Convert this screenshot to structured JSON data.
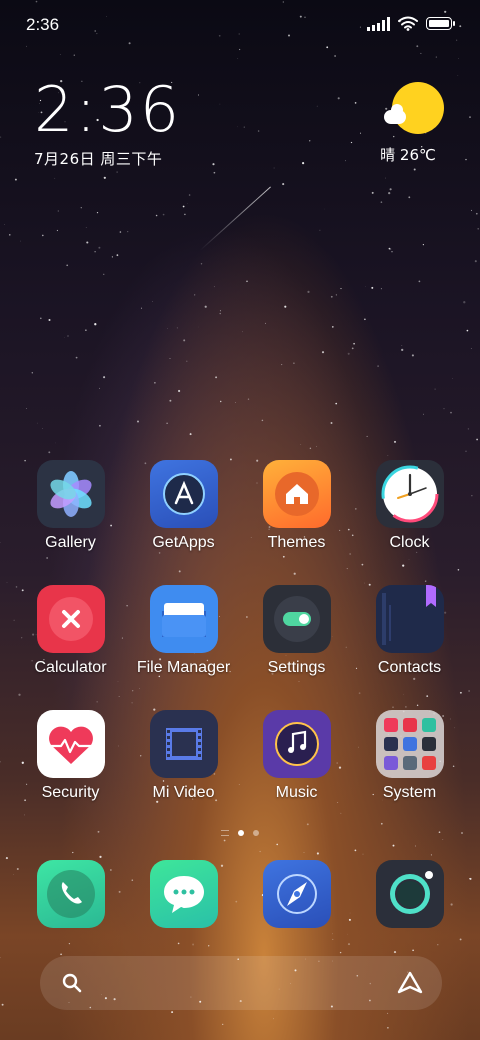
{
  "status_bar": {
    "time": "2:36"
  },
  "clock_widget": {
    "time": "2:36",
    "date": "7月26日 周三下午"
  },
  "weather": {
    "text": "晴 26℃"
  },
  "apps": [
    [
      {
        "label": "Gallery",
        "icon": "gallery-icon"
      },
      {
        "label": "GetApps",
        "icon": "getapps-icon"
      },
      {
        "label": "Themes",
        "icon": "themes-icon"
      },
      {
        "label": "Clock",
        "icon": "clock-icon"
      }
    ],
    [
      {
        "label": "Calculator",
        "icon": "calculator-icon"
      },
      {
        "label": "File Manager",
        "icon": "file-manager-icon"
      },
      {
        "label": "Settings",
        "icon": "settings-icon"
      },
      {
        "label": "Contacts",
        "icon": "contacts-icon"
      }
    ],
    [
      {
        "label": "Security",
        "icon": "security-icon"
      },
      {
        "label": "Mi Video",
        "icon": "mi-video-icon"
      },
      {
        "label": "Music",
        "icon": "music-icon"
      },
      {
        "label": "System",
        "icon": "system-folder-icon"
      }
    ]
  ],
  "dock": [
    {
      "icon": "phone-icon"
    },
    {
      "icon": "messaging-icon"
    },
    {
      "icon": "browser-icon"
    },
    {
      "icon": "camera-icon"
    }
  ],
  "pages": {
    "current": 1,
    "total": 2
  },
  "colors": {
    "accent_yellow": "#ffd21f",
    "settings_toggle": "#4fd6a0",
    "security_red": "#ef3a5a"
  }
}
